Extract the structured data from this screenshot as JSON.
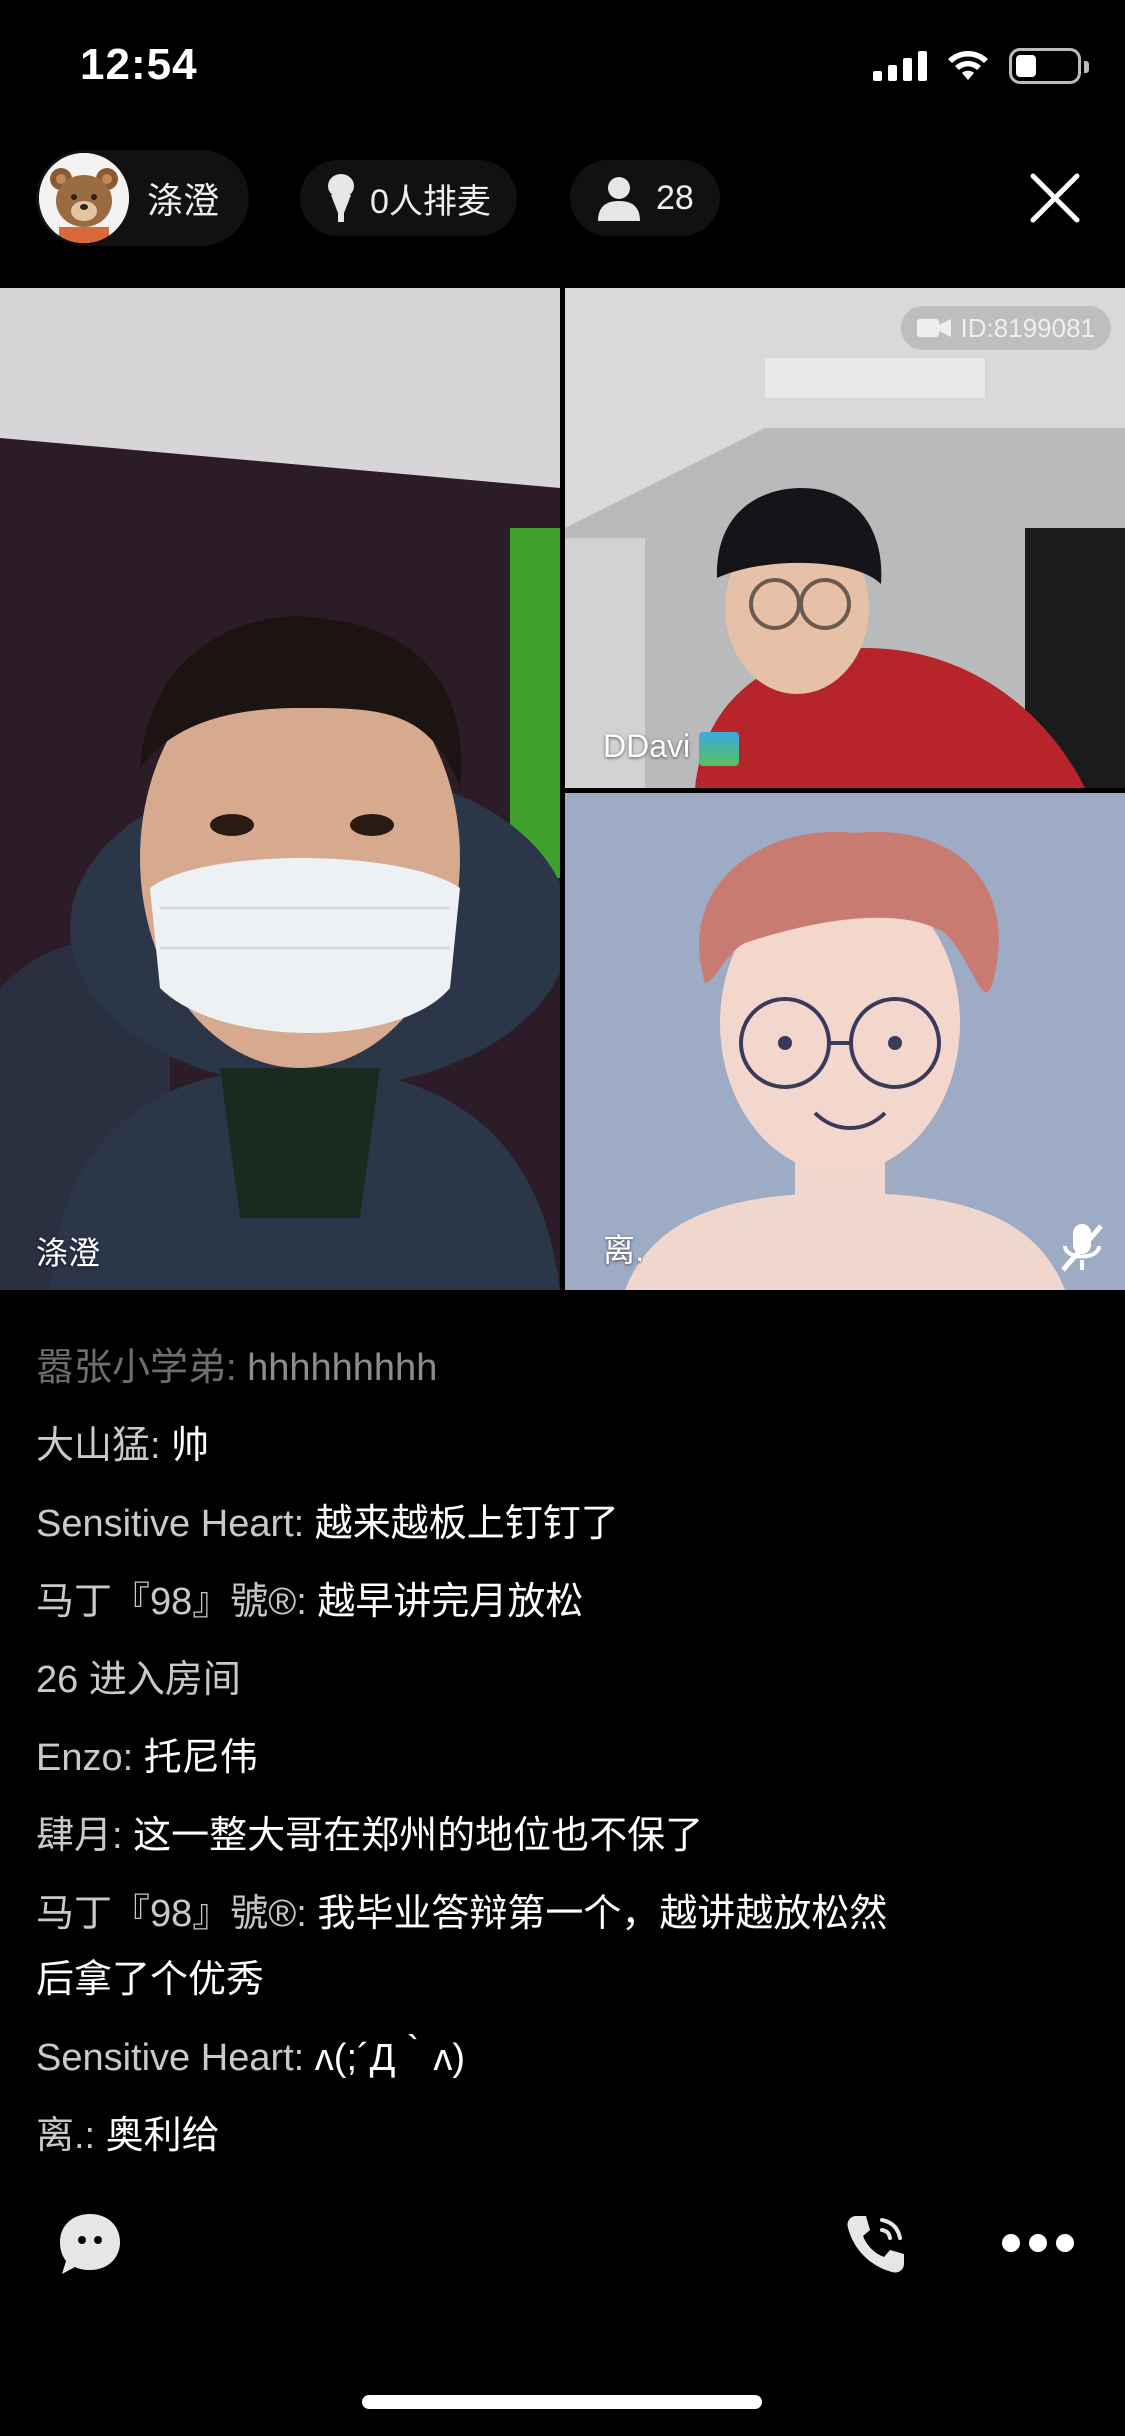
{
  "status_bar": {
    "time": "12:54"
  },
  "header": {
    "host_name": "涤澄",
    "queue_label": "0人排麦",
    "viewer_count": "28"
  },
  "videos": {
    "main_label": "涤澄",
    "top_right_label": "DDavi",
    "top_right_room_id": "ID:8199081",
    "bottom_right_label": "离."
  },
  "chat": {
    "messages": [
      {
        "user": "嚣张小学弟:",
        "text": " hhhhhhhhh"
      },
      {
        "user": "大山猛:",
        "text": " 帅"
      },
      {
        "user": "Sensitive Heart:",
        "text": " 越来越板上钉钉了"
      },
      {
        "user": "马丁『98』號®:",
        "text": " 越早讲完月放松"
      },
      {
        "user": "",
        "text": "26 进入房间"
      },
      {
        "user": "Enzo:",
        "text": " 托尼伟"
      },
      {
        "user": "肆月:",
        "text": " 这一整大哥在郑州的地位也不保了"
      },
      {
        "user": "马丁『98』號®:",
        "text": " 我毕业答辩第一个，越讲越放松然后拿了个优秀"
      },
      {
        "user": "Sensitive Heart:",
        "text": " ʌ(;´Д｀ʌ)"
      },
      {
        "user": "离.:",
        "text": " 奥利给"
      }
    ]
  },
  "colors": {
    "background": "#000000",
    "username": "#c9c9c9",
    "avatar_bg": "#9eabc5"
  }
}
